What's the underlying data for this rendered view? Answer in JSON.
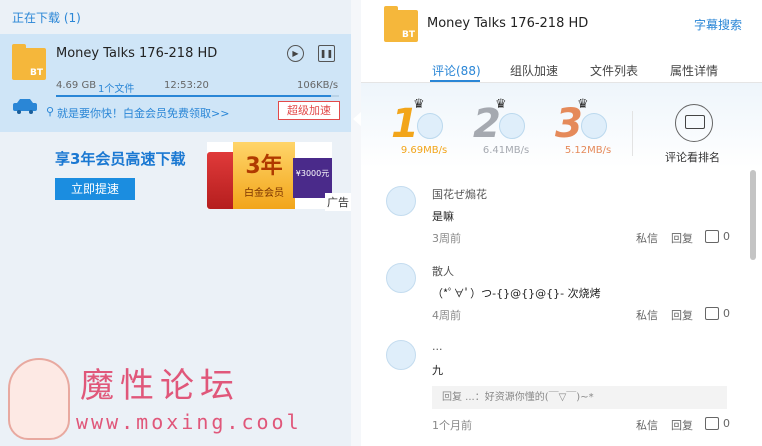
{
  "downloading": {
    "header": "正在下载 (1)",
    "item": {
      "badge": "BT",
      "title": "Money Talks 176-218 HD",
      "size": "4.69 GB",
      "files": "1个文件",
      "elapsed": "12:53:20",
      "speed": "106KB/s",
      "progress": 0.97,
      "promo": "就是要你快！白金会员免费领取>>",
      "super_button": "超级加速"
    }
  },
  "ad": {
    "title": "享3年会员高速下载",
    "button": "立即提速",
    "badge_big": "3年",
    "badge_small": "白金会员",
    "side": "¥3000元",
    "tag": "广告"
  },
  "watermark": {
    "title": "魔性论坛",
    "url": "www.moxing.cool"
  },
  "detail": {
    "badge": "BT",
    "title": "Money Talks 176-218 HD",
    "subtitle_search": "字幕搜索",
    "tabs": [
      "评论(88)",
      "组队加速",
      "文件列表",
      "属性详情"
    ],
    "ranks": [
      {
        "num": "1",
        "speed": "9.69MB/s",
        "color": "#f2a51a"
      },
      {
        "num": "2",
        "speed": "6.41MB/s",
        "color": "#a5a9b0"
      },
      {
        "num": "3",
        "speed": "5.12MB/s",
        "color": "#e58a5a"
      }
    ],
    "comment_rank_label": "评论看排名"
  },
  "comments": [
    {
      "user": "国花ぜ煽花",
      "text": "是嘛",
      "time": "3周前",
      "private": "私信",
      "reply": "回复",
      "likes": "0"
    },
    {
      "user": "散人",
      "text": "（*ﾟ∀ﾟ）つ-{}@{}@{}- 次烧烤",
      "time": "4周前",
      "private": "私信",
      "reply": "回复",
      "likes": "0"
    },
    {
      "user": "...",
      "text": "九",
      "reply_quote": "回复 ...：好资源你懂的(￣▽￣)~*",
      "time": "1个月前",
      "private": "私信",
      "reply": "回复",
      "likes": "0"
    }
  ]
}
